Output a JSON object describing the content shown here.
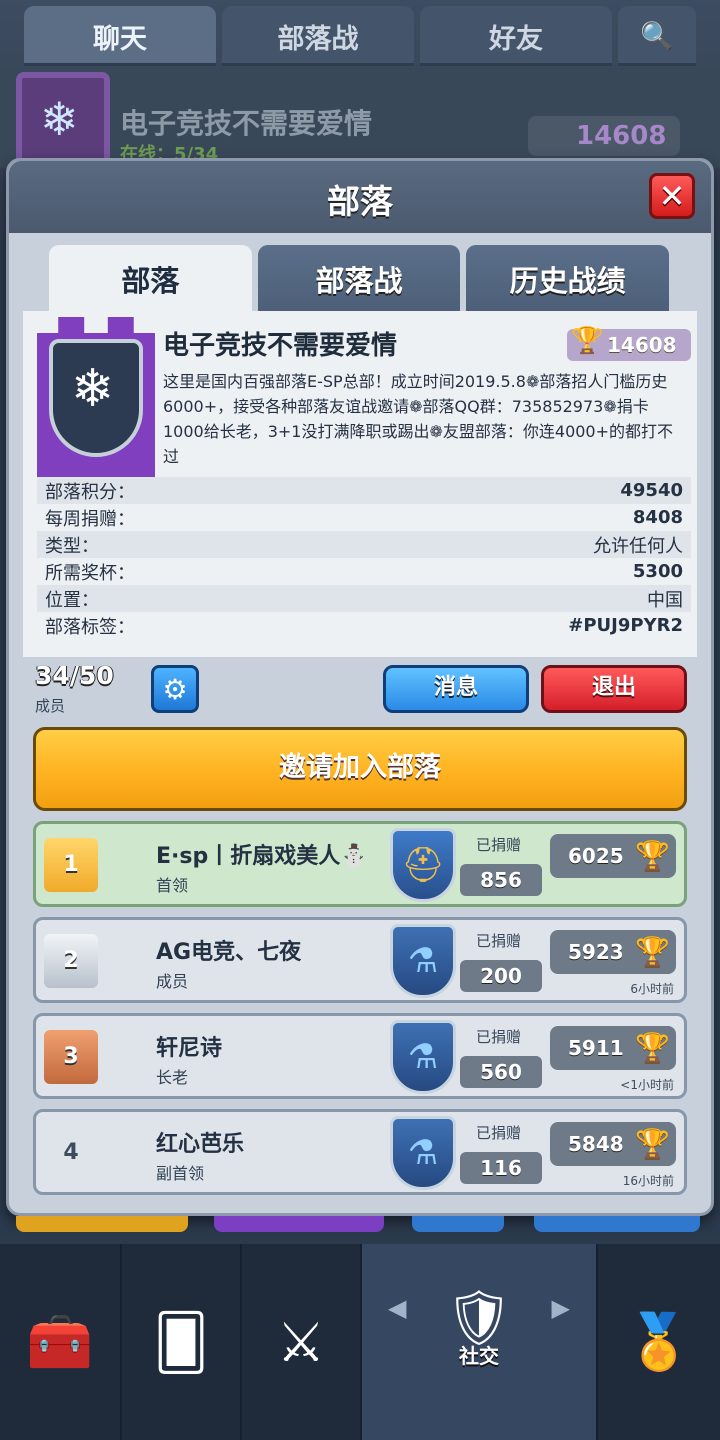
{
  "top_tabs": [
    "聊天",
    "部落战",
    "好友"
  ],
  "clan_behind": {
    "name": "电子竞技不需要爱情",
    "online": "在线：5/34",
    "trophies": "14608"
  },
  "modal": {
    "title": "部落",
    "tabs": [
      "部落",
      "部落战",
      "历史战绩"
    ],
    "clan_name": "电子竞技不需要爱情",
    "trophies": "14608",
    "description": "这里是国内百强部落E-SP总部！成立时间2019.5.8❁部落招人门槛历史6000+，接受各种部落友谊战邀请❁部落QQ群：735852973❁捐卡1000给长老，3+1没打满降职或踢出❁友盟部落：你连4000+的都打不过",
    "stats": [
      {
        "label": "部落积分：",
        "value": "49540"
      },
      {
        "label": "每周捐赠：",
        "value": "8408"
      },
      {
        "label": "类型：",
        "value": "允许任何人"
      },
      {
        "label": "所需奖杯：",
        "value": "5300"
      },
      {
        "label": "位置：",
        "value": "中国"
      },
      {
        "label": "部落标签：",
        "value": "#PUJ9PYR2"
      }
    ],
    "member_count": "34/50",
    "member_label": "成员",
    "message_button": "消息",
    "quit_button": "退出",
    "invite_button": "邀请加入部落",
    "donation_label": "已捐赠",
    "members": [
      {
        "rank": "1",
        "name": "E·sp丨折扇戏美人⛄",
        "role": "首领",
        "donated": "856",
        "trophies": "6025",
        "last_seen": ""
      },
      {
        "rank": "2",
        "name": "AG电竞、七夜",
        "role": "成员",
        "donated": "200",
        "trophies": "5923",
        "last_seen": "6小时前"
      },
      {
        "rank": "3",
        "name": "轩尼诗",
        "role": "长老",
        "donated": "560",
        "trophies": "5911",
        "last_seen": "<1小时前"
      },
      {
        "rank": "4",
        "name": "红心芭乐",
        "role": "副首领",
        "donated": "116",
        "trophies": "5848",
        "last_seen": "16小时前"
      }
    ]
  },
  "bottom_nav": {
    "active_label": "社交"
  },
  "colors": {
    "accent_yellow": "#ffb321",
    "red_button": "#d51f2a",
    "blue_button": "#2a8ae6"
  }
}
